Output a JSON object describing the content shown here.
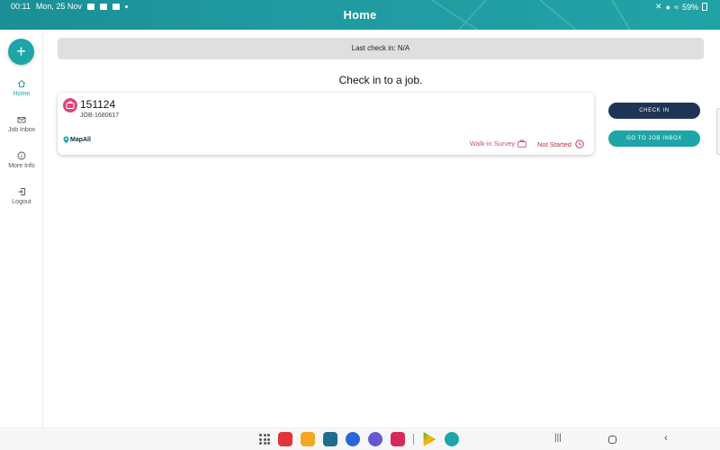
{
  "status_bar": {
    "time": "00:11",
    "date": "Mon, 25 Nov",
    "battery": "59%"
  },
  "header": {
    "title": "Home"
  },
  "sidebar": {
    "fab_symbol": "+",
    "items": [
      {
        "label": "Home",
        "icon": "home-icon",
        "active": true
      },
      {
        "label": "Job Inbox",
        "icon": "mail-icon",
        "active": false
      },
      {
        "label": "More Info",
        "icon": "info-icon",
        "active": false
      },
      {
        "label": "Logout",
        "icon": "logout-icon",
        "active": false
      }
    ]
  },
  "main": {
    "last_check_in": "Last check in: N/A",
    "heading": "Check in to a job.",
    "job": {
      "number": "151124",
      "reference": "JOB-1680617",
      "brand": "MapAll",
      "type": "Walk-in Survey",
      "status": "Not Started"
    },
    "buttons": {
      "check_in": "CHECK IN",
      "go_to_inbox": "GO TO JOB INBOX"
    }
  },
  "colors": {
    "accent": "#1ea5a8",
    "primary_dark": "#1e3557",
    "job_type": "#d24a67",
    "status": "#b8323f"
  },
  "dock_apps": [
    "apps-grid-icon",
    "app-red-icon",
    "files-icon",
    "calendar-icon",
    "messages-icon",
    "internet-icon",
    "camera-icon",
    "play-store-icon",
    "mapall-app-icon"
  ]
}
